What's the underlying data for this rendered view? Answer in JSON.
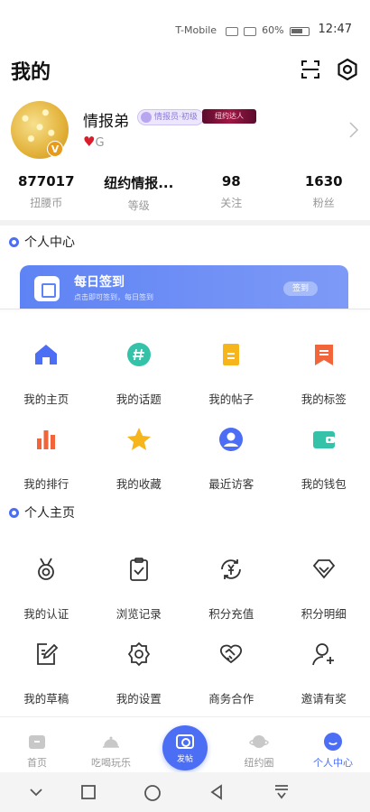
{
  "status": {
    "carrier": "T-Mobile",
    "battery": "60%",
    "time": "12:47"
  },
  "header": {
    "title": "我的"
  },
  "profile": {
    "name": "情报弟",
    "level_badge": "情报员·初级",
    "title_badge": "纽约达人",
    "gender_text": "G"
  },
  "stats": [
    {
      "value": "877017",
      "label": "扭腰币"
    },
    {
      "value": "纽约情报...",
      "label": "等级"
    },
    {
      "value": "98",
      "label": "关注"
    },
    {
      "value": "1630",
      "label": "粉丝"
    }
  ],
  "section_center": {
    "title": "个人中心"
  },
  "signin": {
    "title": "每日签到",
    "subtitle": "点击即可签到，每日签到",
    "button": "签到"
  },
  "grid_center": [
    {
      "label": "我的主页",
      "icon": "home-icon",
      "color": "#4b6ef5"
    },
    {
      "label": "我的话题",
      "icon": "hashtag-icon",
      "color": "#34c2a8"
    },
    {
      "label": "我的帖子",
      "icon": "document-icon",
      "color": "#f5b51b"
    },
    {
      "label": "我的标签",
      "icon": "bookmark-icon",
      "color": "#f2653a"
    },
    {
      "label": "我的排行",
      "icon": "ranking-icon",
      "color": "#f2653a"
    },
    {
      "label": "我的收藏",
      "icon": "star-icon",
      "color": "#f5b51b"
    },
    {
      "label": "最近访客",
      "icon": "visitor-icon",
      "color": "#4b6ef5"
    },
    {
      "label": "我的钱包",
      "icon": "wallet-icon",
      "color": "#34c2a8"
    }
  ],
  "section_home": {
    "title": "个人主页"
  },
  "grid_home": [
    {
      "label": "我的认证",
      "icon": "medal-icon"
    },
    {
      "label": "浏览记录",
      "icon": "clipboard-icon"
    },
    {
      "label": "积分充值",
      "icon": "yen-refresh-icon"
    },
    {
      "label": "积分明细",
      "icon": "diamond-icon"
    },
    {
      "label": "我的草稿",
      "icon": "edit-icon"
    },
    {
      "label": "我的设置",
      "icon": "settings-icon"
    },
    {
      "label": "商务合作",
      "icon": "handshake-icon"
    },
    {
      "label": "邀请有奖",
      "icon": "add-user-icon"
    }
  ],
  "bottom_nav": [
    {
      "label": "首页",
      "icon": "home-tab-icon",
      "active": false
    },
    {
      "label": "吃喝玩乐",
      "icon": "dish-icon",
      "active": false
    },
    {
      "label": "发帖",
      "icon": "camera-icon",
      "active": false
    },
    {
      "label": "纽约圈",
      "icon": "planet-icon",
      "active": false
    },
    {
      "label": "个人中心",
      "icon": "profile-tab-icon",
      "active": true
    }
  ],
  "colors": {
    "accent": "#4b6ef5",
    "accent_light": "#7e9af7"
  }
}
